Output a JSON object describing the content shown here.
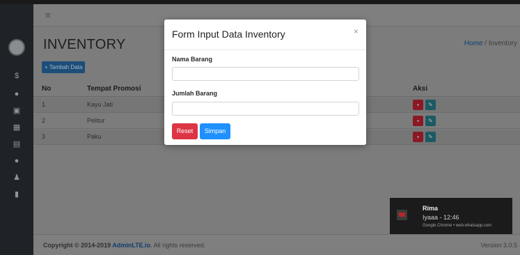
{
  "header": {
    "menu_icon": "hamburger-icon"
  },
  "sidebar": {
    "icons": [
      "avatar",
      "dollar-icon",
      "circle-icon",
      "image-icon",
      "chart-icon",
      "calculator-icon",
      "info-icon",
      "users-icon",
      "book-icon"
    ]
  },
  "page": {
    "title": "INVENTORY",
    "breadcrumb_home": "Home",
    "breadcrumb_sep": "/",
    "breadcrumb_current": "Inventory",
    "add_button": "+ Tambah Data"
  },
  "table": {
    "headers": {
      "no": "No",
      "tempat": "Tempat Promosi",
      "aksi": "Aksi"
    },
    "rows": [
      {
        "no": "1",
        "tempat": "Kayu Jati"
      },
      {
        "no": "2",
        "tempat": "Pelitur"
      },
      {
        "no": "3",
        "tempat": "Paku"
      }
    ]
  },
  "modal": {
    "title": "Form Input Data Inventory",
    "close": "×",
    "field1_label": "Nama Barang",
    "field1_value": "",
    "field2_label": "Jumlah Barang",
    "field2_value": "",
    "reset_label": "Reset",
    "save_label": "Simpan"
  },
  "footer": {
    "copyright_prefix": "Copyright © 2014-2019 ",
    "brand": "AdminLTE.io",
    "suffix": ". All rights reserved.",
    "version": "Version 3.0.5"
  },
  "notification": {
    "title": "Rima",
    "message": "Iyaaa - 12:46",
    "source": "Google Chrome • web.whatsapp.com"
  },
  "colors": {
    "danger": "#dc3545",
    "primary": "#1e90ff",
    "sidebar": "#1f2226"
  }
}
